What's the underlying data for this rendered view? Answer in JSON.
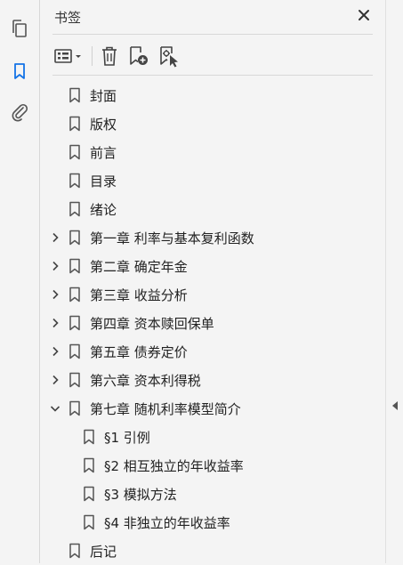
{
  "panel": {
    "title": "书签"
  },
  "bookmarks": [
    {
      "label": "封面",
      "level": 0,
      "expander": "none"
    },
    {
      "label": "版权",
      "level": 0,
      "expander": "none"
    },
    {
      "label": "前言",
      "level": 0,
      "expander": "none"
    },
    {
      "label": "目录",
      "level": 0,
      "expander": "none"
    },
    {
      "label": "绪论",
      "level": 0,
      "expander": "none"
    },
    {
      "label": "第一章 利率与基本复利函数",
      "level": 0,
      "expander": "collapsed"
    },
    {
      "label": "第二章 确定年金",
      "level": 0,
      "expander": "collapsed"
    },
    {
      "label": "第三章 收益分析",
      "level": 0,
      "expander": "collapsed"
    },
    {
      "label": "第四章 资本赎回保单",
      "level": 0,
      "expander": "collapsed"
    },
    {
      "label": "第五章 债券定价",
      "level": 0,
      "expander": "collapsed"
    },
    {
      "label": "第六章 资本利得税",
      "level": 0,
      "expander": "collapsed"
    },
    {
      "label": "第七章 随机利率模型简介",
      "level": 0,
      "expander": "expanded"
    },
    {
      "label": "§1 引例",
      "level": 1,
      "expander": "none"
    },
    {
      "label": "§2 相互独立的年收益率",
      "level": 1,
      "expander": "none"
    },
    {
      "label": "§3 模拟方法",
      "level": 1,
      "expander": "none"
    },
    {
      "label": "§4 非独立的年收益率",
      "level": 1,
      "expander": "none"
    },
    {
      "label": "后记",
      "level": 0,
      "expander": "none"
    }
  ],
  "icons": {
    "rail": [
      "pages-icon",
      "bookmark-icon",
      "attachment-icon"
    ],
    "toolbar": [
      "options-menu-icon",
      "delete-icon",
      "new-bookmark-icon",
      "bookmark-from-selection-icon"
    ]
  },
  "colors": {
    "accent": "#1473e6",
    "icon": "#555555",
    "background": "#f4f4f4"
  }
}
